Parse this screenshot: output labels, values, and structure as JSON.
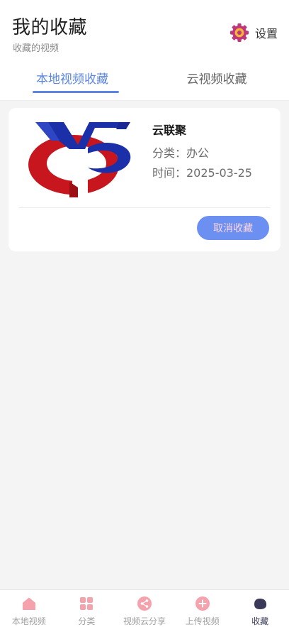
{
  "header": {
    "title": "我的收藏",
    "subtitle": "收藏的视频",
    "settings_label": "设置"
  },
  "tabs": [
    {
      "label": "本地视频收藏",
      "active": true
    },
    {
      "label": "云视频收藏",
      "active": false
    }
  ],
  "favorites": [
    {
      "title": "云联聚",
      "category": "分类：办公",
      "time": "时间：2025-03-25",
      "unfavorite_label": "取消收藏"
    }
  ],
  "bottom_nav": [
    {
      "label": "本地视频",
      "icon": "home-icon",
      "active": false
    },
    {
      "label": "分类",
      "icon": "grid-icon",
      "active": false
    },
    {
      "label": "视频云分享",
      "icon": "share-icon",
      "active": false
    },
    {
      "label": "上传视频",
      "icon": "plus-icon",
      "active": false
    },
    {
      "label": "收藏",
      "icon": "favorite-icon",
      "active": true
    }
  ],
  "colors": {
    "accent": "#5b86e5",
    "button": "#6c90f2",
    "nav_icon": "#f6a2ad",
    "nav_active": "#3a3a58",
    "logo_red": "#c7161d",
    "logo_blue": "#1b2fa8"
  }
}
